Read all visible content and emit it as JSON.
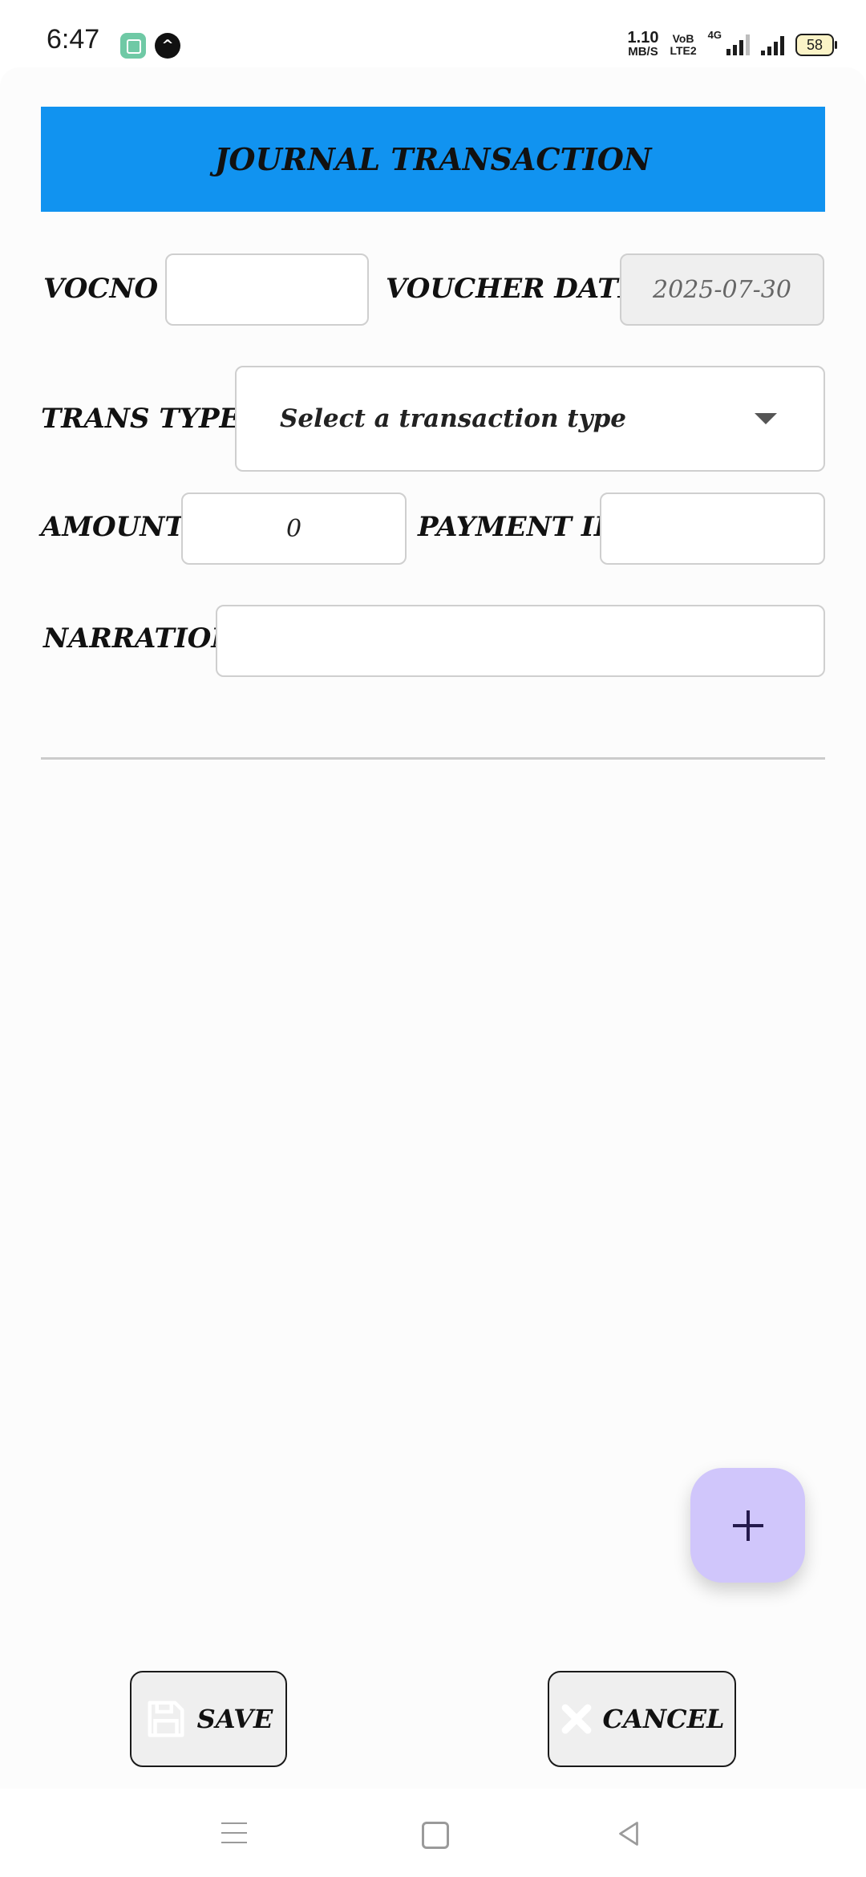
{
  "status_bar": {
    "time": "6:47",
    "net_speed_value": "1.10",
    "net_speed_unit": "MB/S",
    "volte_top": "VoB",
    "volte_bottom": "LTE2",
    "network_type": "4G",
    "battery": "58"
  },
  "header": {
    "title": "JOURNAL TRANSACTION",
    "color": "#1193f0"
  },
  "form": {
    "vocno_label": "VOCNO :",
    "vocno_value": "",
    "voucher_date_label": "VOUCHER DATE :",
    "voucher_date_value": "2025-07-30",
    "trans_type_label": "TRANS TYPE :",
    "trans_type_placeholder": "Select a transaction type",
    "amount_label": "AMOUNT :",
    "amount_value": "0",
    "payment_id_label": "PAYMENT ID :",
    "payment_id_value": "",
    "narration_label": "NARRATION :",
    "narration_value": ""
  },
  "actions": {
    "save_label": "SAVE",
    "cancel_label": "CANCEL",
    "fab_icon": "plus-icon",
    "fab_color": "#d0c6fb"
  },
  "nav": {
    "icons": [
      "menu-icon",
      "home-icon",
      "back-icon"
    ]
  }
}
